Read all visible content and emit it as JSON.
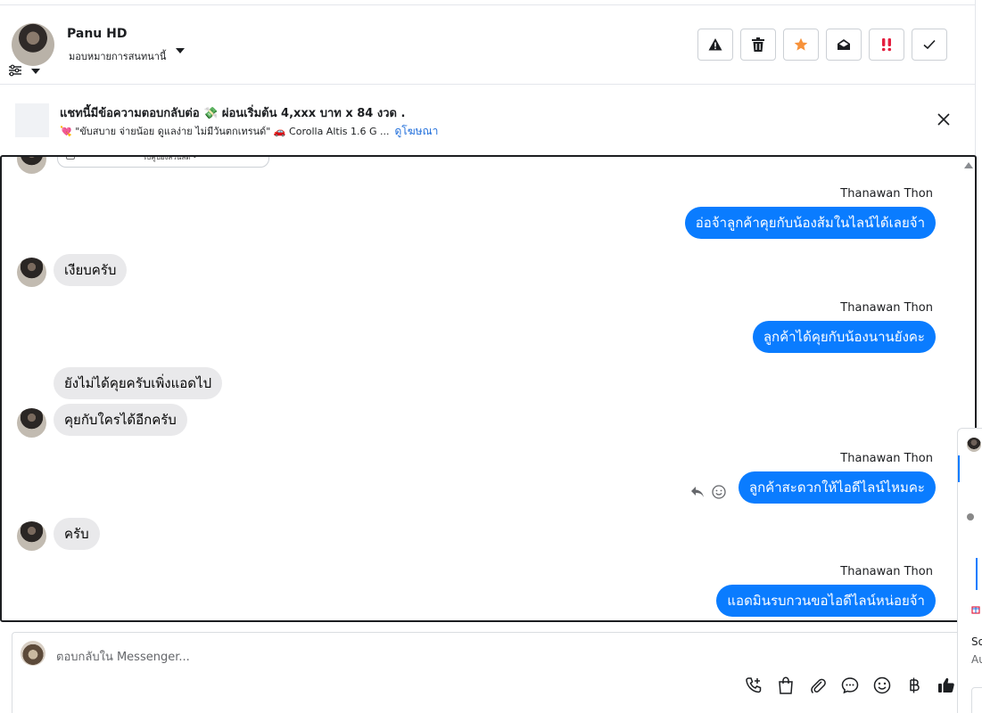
{
  "header": {
    "name": "Panu HD",
    "assign_label": "มอบหมายการสนทนานี้"
  },
  "actions": [
    {
      "name": "report-spam-button",
      "icon": "warning-icon"
    },
    {
      "name": "delete-button",
      "icon": "trash-icon"
    },
    {
      "name": "star-button",
      "icon": "star-icon",
      "color": "#f7923a"
    },
    {
      "name": "mark-unread-button",
      "icon": "envelope-open-icon"
    },
    {
      "name": "follow-up-button",
      "icon": "double-exclamation-icon",
      "color": "#e41e3f"
    },
    {
      "name": "done-button",
      "icon": "check-icon"
    }
  ],
  "ad": {
    "title": "แชทนี้มีข้อความตอบกลับต่อ 💸 ผ่อนเริ่มต้น 4,xxx บาท x 84 งวด .",
    "subtitle": "💘 \"ขับสบาย จ่ายน้อย ดูแลง่าย ไม่มีวันตกเทรนด์\" 🚗 Corolla Altis 1.6 G ...",
    "link": "ดูโฆษณา"
  },
  "prev_card_text": "รับคูปองส่วนลด •",
  "messages": [
    {
      "dir": "out",
      "sender": "Thanawan Thon",
      "text": "อ่อจ้าลูกค้าคุยกับน้องส้มในไลน์ได้เลยจ้า"
    },
    {
      "dir": "in",
      "text": "เงียบครับ"
    },
    {
      "dir": "out",
      "sender": "Thanawan Thon",
      "text": "ลูกค้าได้คุยกับน้องนานยังคะ"
    },
    {
      "dir": "in",
      "text": "ยังไม่ได้คุยครับเพิ่งแอดไป"
    },
    {
      "dir": "in",
      "text": "คุยกับใครได้อีกครับ"
    },
    {
      "dir": "out",
      "sender": "Thanawan Thon",
      "text": "ลูกค้าสะดวกให้ไอดีไลน์ไหมคะ"
    },
    {
      "dir": "in",
      "text": "ครับ"
    },
    {
      "dir": "out",
      "sender": "Thanawan Thon",
      "text": "แอดมินรบกวนขอไอดีไลน์หน่อยจ้า"
    }
  ],
  "composer": {
    "placeholder": "ตอบกลับใน Messenger..."
  },
  "side_panel": {
    "line1": "So",
    "line2": "Au"
  },
  "colors": {
    "outgoing_bubble": "#0a7cff",
    "incoming_bubble": "#e9e9eb",
    "link": "#216fdb"
  }
}
